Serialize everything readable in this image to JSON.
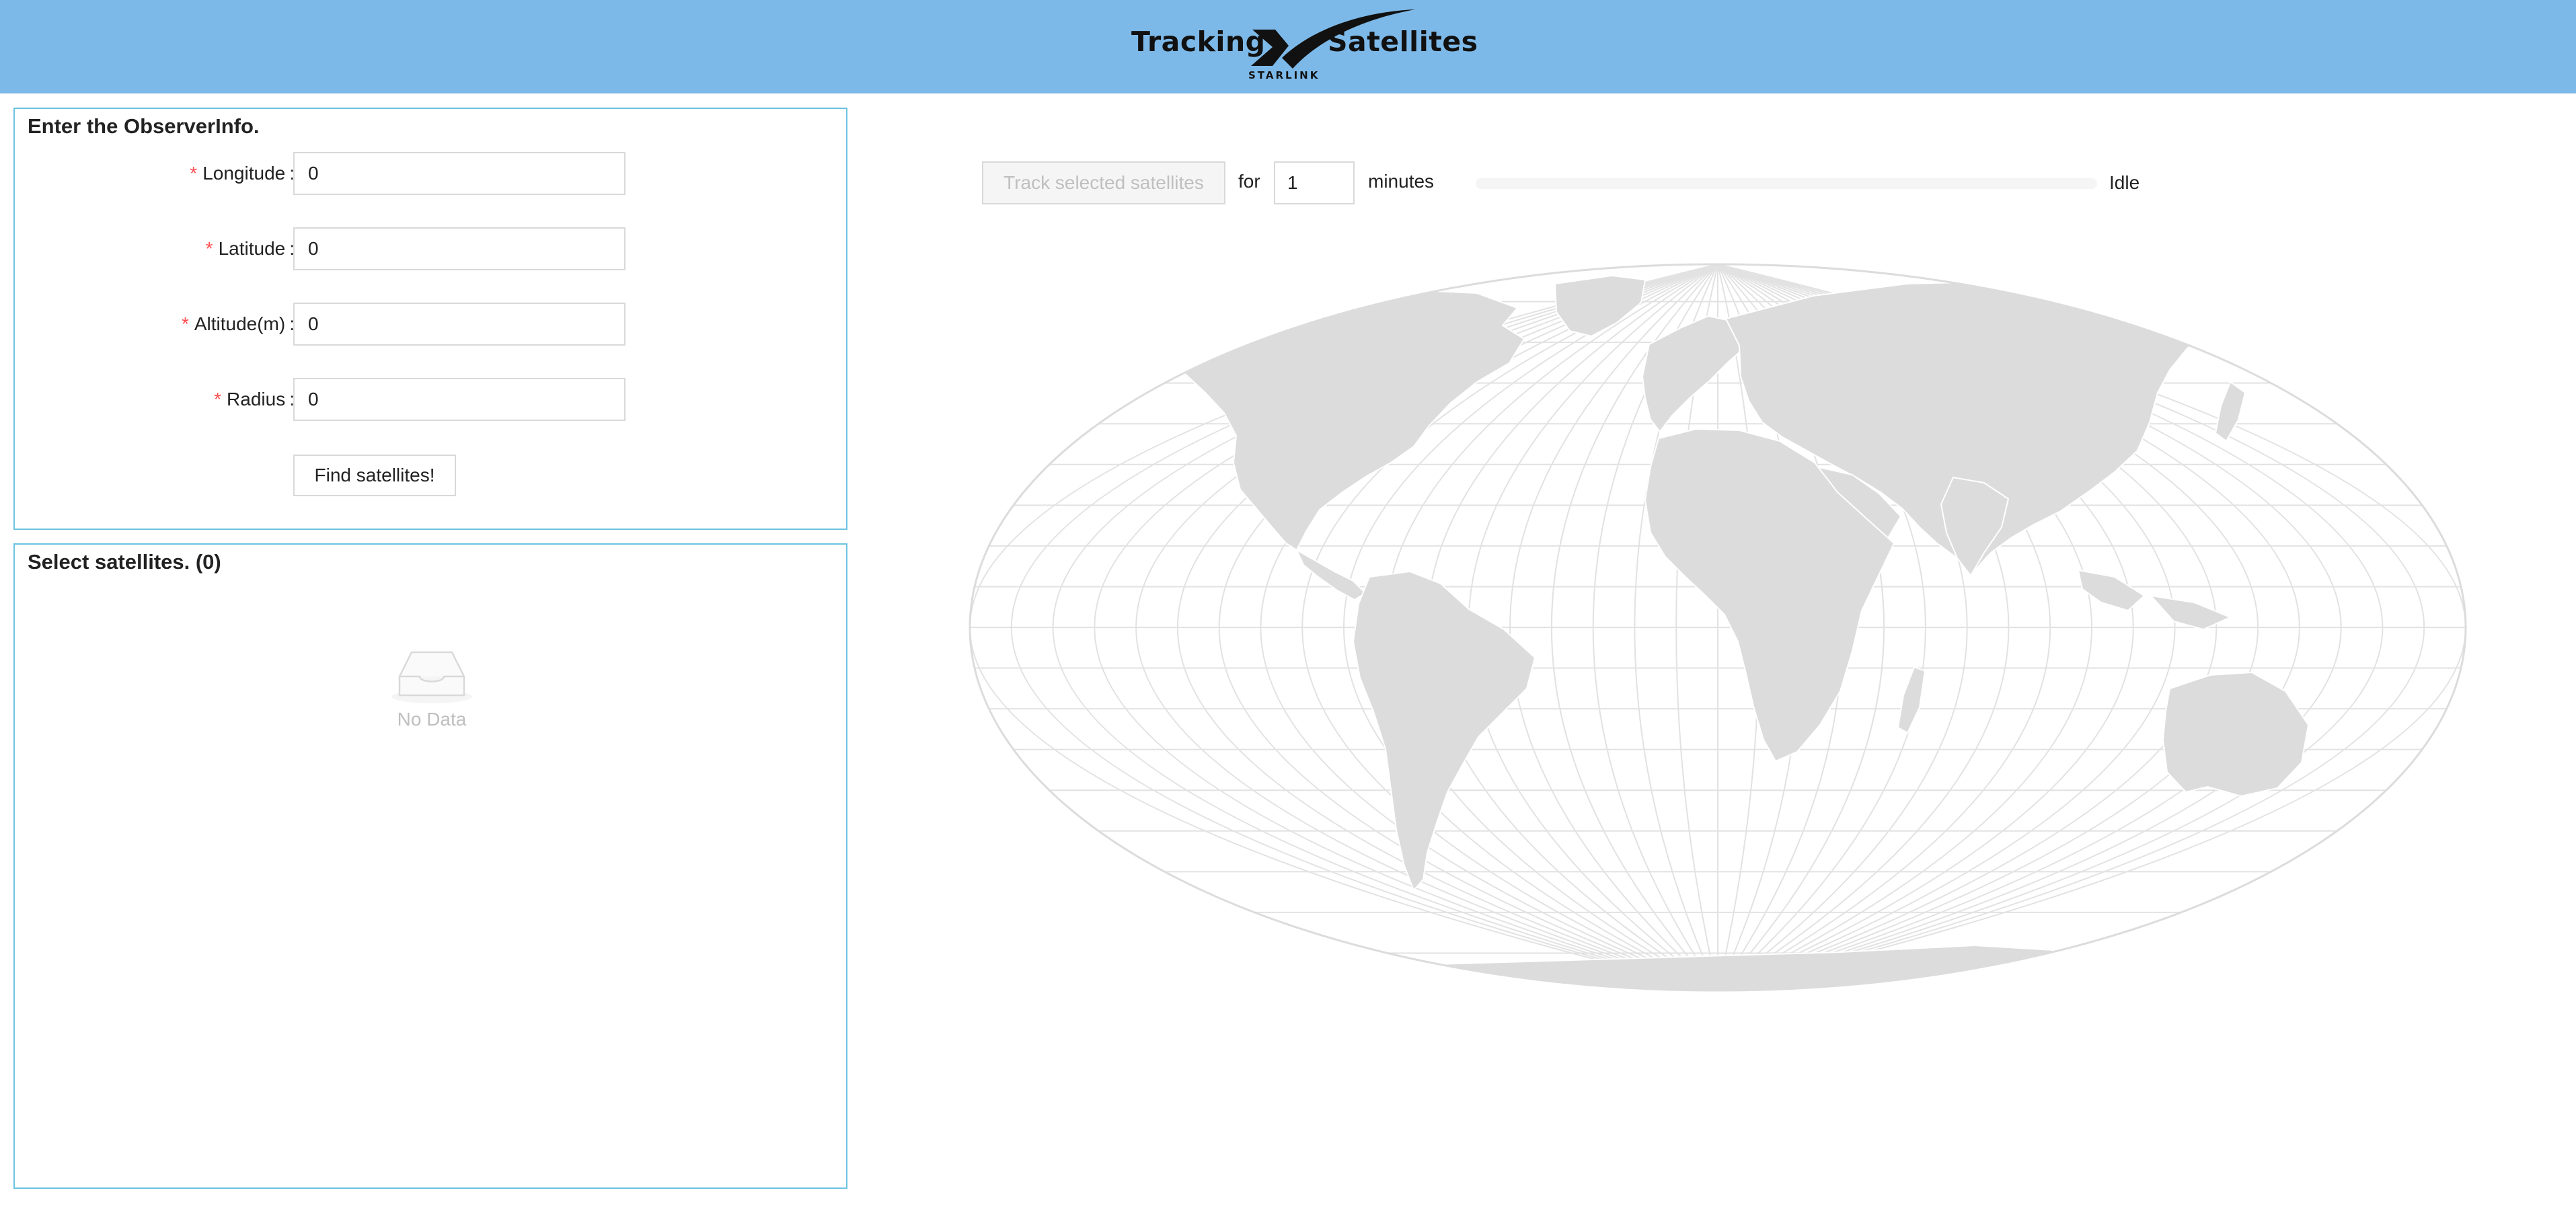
{
  "header": {
    "title_left": "Tracking",
    "title_right": "Satellites",
    "brand": "STARLINK",
    "logo_icon": "starlink-x-logo-icon",
    "background_color": "#7db9e8"
  },
  "observer": {
    "title": "Enter the ObserverInfo.",
    "fields": [
      {
        "label": "Longitude",
        "value": "0"
      },
      {
        "label": "Latitude",
        "value": "0"
      },
      {
        "label": "Altitude(m)",
        "value": "0"
      },
      {
        "label": "Radius",
        "value": "0"
      }
    ],
    "required_mark": "*",
    "colon": ":",
    "submit_label": "Find satellites!"
  },
  "satellites": {
    "title": "Select satellites. (0)",
    "empty_icon": "empty-inbox-icon",
    "empty_text": "No Data"
  },
  "tracking": {
    "button_label": "Track selected satellites",
    "for_label": "for",
    "minutes_value": "1",
    "minutes_label": "minutes",
    "progress": 0,
    "status": "Idle"
  },
  "map": {
    "icon": "world-map-icon",
    "land_color": "#dcdcdc",
    "graticule_color": "#e2e2e2"
  },
  "colors": {
    "panel_border": "#6cc3e0",
    "required": "#ff4d4f"
  }
}
